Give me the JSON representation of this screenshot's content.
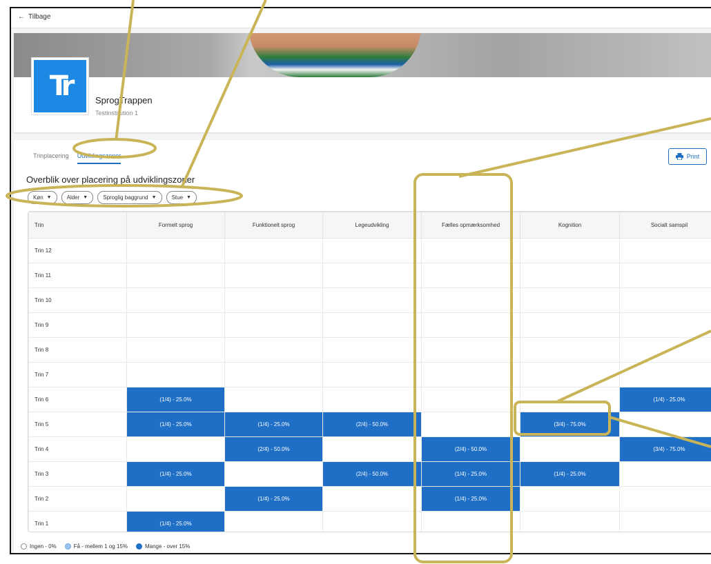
{
  "topbar": {
    "back_label": "Tilbage"
  },
  "header": {
    "org_name": "SprogTrappen",
    "org_sub": "Testinstitution 1",
    "logo_text": "Tr"
  },
  "tabs": [
    {
      "label": "Trinplacering",
      "active": false
    },
    {
      "label": "Udviklingszoner",
      "active": true
    }
  ],
  "print_label": "Print",
  "section_title": "Overblik over placering på udviklingszoner",
  "filters": [
    {
      "label": "Køn"
    },
    {
      "label": "Alder"
    },
    {
      "label": "Sproglig baggrund"
    },
    {
      "label": "Stue"
    }
  ],
  "table": {
    "columns": [
      "Trin",
      "Formelt sprog",
      "Funktionelt sprog",
      "Legeudvikling",
      "Fælles opmærksomhed",
      "Kognition",
      "Socialt samspil"
    ],
    "rows": [
      {
        "label": "Trin 12",
        "cells": [
          "",
          "",
          "",
          "",
          "",
          ""
        ]
      },
      {
        "label": "Trin 11",
        "cells": [
          "",
          "",
          "",
          "",
          "",
          ""
        ]
      },
      {
        "label": "Trin 10",
        "cells": [
          "",
          "",
          "",
          "",
          "",
          ""
        ]
      },
      {
        "label": "Trin 9",
        "cells": [
          "",
          "",
          "",
          "",
          "",
          ""
        ]
      },
      {
        "label": "Trin 8",
        "cells": [
          "",
          "",
          "",
          "",
          "",
          ""
        ]
      },
      {
        "label": "Trin 7",
        "cells": [
          "",
          "",
          "",
          "",
          "",
          ""
        ]
      },
      {
        "label": "Trin 6",
        "cells": [
          "(1/4) - 25.0%",
          "",
          "",
          "",
          "",
          "(1/4) - 25.0%"
        ]
      },
      {
        "label": "Trin 5",
        "cells": [
          "(1/4) - 25.0%",
          "(1/4) - 25.0%",
          "(2/4) - 50.0%",
          "",
          "(3/4) - 75.0%",
          ""
        ]
      },
      {
        "label": "Trin 4",
        "cells": [
          "",
          "(2/4) - 50.0%",
          "",
          "(2/4) - 50.0%",
          "",
          "(3/4) - 75.0%"
        ]
      },
      {
        "label": "Trin 3",
        "cells": [
          "(1/4) - 25.0%",
          "",
          "(2/4) - 50.0%",
          "(1/4) - 25.0%",
          "(1/4) - 25.0%",
          ""
        ]
      },
      {
        "label": "Trin 2",
        "cells": [
          "",
          "(1/4) - 25.0%",
          "",
          "(1/4) - 25.0%",
          "",
          ""
        ]
      },
      {
        "label": "Trin 1",
        "cells": [
          "(1/4) - 25.0%",
          "",
          "",
          "",
          "",
          ""
        ]
      }
    ]
  },
  "legend": {
    "ingen": "Ingen - 0%",
    "faa": "Få - mellem 1 og 15%",
    "mange": "Mange - over 15%"
  },
  "colors": {
    "accent": "#1e6fc2",
    "cell_mange": "#1f6fc7",
    "annotation": "#c9b458"
  }
}
